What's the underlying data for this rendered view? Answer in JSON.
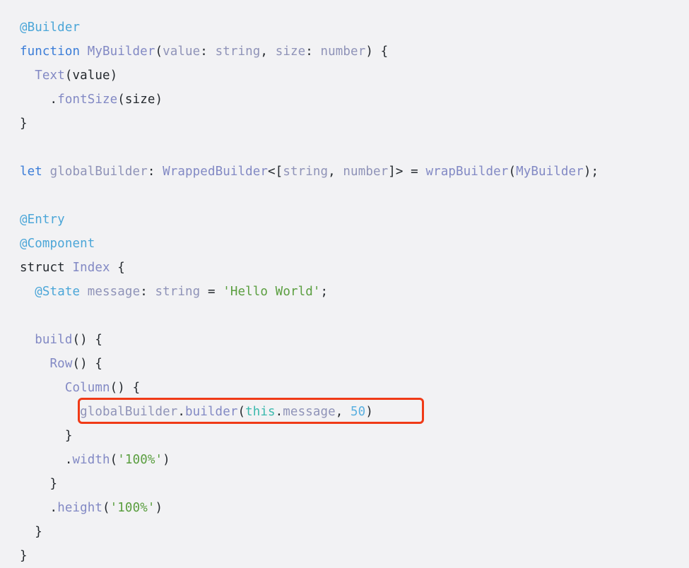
{
  "editor": {
    "background_color": "#f2f2f4",
    "default_text_color": "#24292e",
    "font_size_px": 17.5,
    "line_height_px": 34
  },
  "annotation": {
    "type": "rectangle-highlight",
    "color": "#f03a17",
    "border_width_px": 3,
    "border_radius_px": 6,
    "target_line_index": 16,
    "target_text": "globalBuilder.builder(this.message, 50)"
  },
  "colors": {
    "decorator": "#4ba6d8",
    "keyword": "#3b7dd8",
    "function_name": "#8289c4",
    "identifier": "#8f93b8",
    "type_name": "#8289c4",
    "plain": "#24292e",
    "string": "#5a9e3f",
    "this_keyword": "#3bb9ad",
    "number": "#5bb0e0"
  },
  "code": {
    "language": "ArkTS",
    "lines": [
      {
        "indent": 0,
        "tokens": [
          {
            "t": "@Builder",
            "c": "decorator"
          }
        ]
      },
      {
        "indent": 0,
        "tokens": [
          {
            "t": "function",
            "c": "keyword"
          },
          {
            "t": " ",
            "c": "plain"
          },
          {
            "t": "MyBuilder",
            "c": "function_name"
          },
          {
            "t": "(",
            "c": "plain"
          },
          {
            "t": "value",
            "c": "identifier"
          },
          {
            "t": ": ",
            "c": "plain"
          },
          {
            "t": "string",
            "c": "identifier"
          },
          {
            "t": ", ",
            "c": "plain"
          },
          {
            "t": "size",
            "c": "identifier"
          },
          {
            "t": ": ",
            "c": "plain"
          },
          {
            "t": "number",
            "c": "identifier"
          },
          {
            "t": ") {",
            "c": "plain"
          }
        ]
      },
      {
        "indent": 1,
        "tokens": [
          {
            "t": "Text",
            "c": "function_name"
          },
          {
            "t": "(value)",
            "c": "plain"
          }
        ]
      },
      {
        "indent": 2,
        "tokens": [
          {
            "t": ".",
            "c": "plain"
          },
          {
            "t": "fontSize",
            "c": "function_name"
          },
          {
            "t": "(size)",
            "c": "plain"
          }
        ]
      },
      {
        "indent": 0,
        "tokens": [
          {
            "t": "}",
            "c": "plain"
          }
        ]
      },
      {
        "indent": 0,
        "tokens": []
      },
      {
        "indent": 0,
        "tokens": [
          {
            "t": "let",
            "c": "keyword"
          },
          {
            "t": " ",
            "c": "plain"
          },
          {
            "t": "globalBuilder",
            "c": "identifier"
          },
          {
            "t": ": ",
            "c": "plain"
          },
          {
            "t": "WrappedBuilder",
            "c": "type_name"
          },
          {
            "t": "<[",
            "c": "plain"
          },
          {
            "t": "string",
            "c": "identifier"
          },
          {
            "t": ", ",
            "c": "plain"
          },
          {
            "t": "number",
            "c": "identifier"
          },
          {
            "t": "]> = ",
            "c": "plain"
          },
          {
            "t": "wrapBuilder",
            "c": "function_name"
          },
          {
            "t": "(",
            "c": "plain"
          },
          {
            "t": "MyBuilder",
            "c": "function_name"
          },
          {
            "t": ");",
            "c": "plain"
          }
        ]
      },
      {
        "indent": 0,
        "tokens": []
      },
      {
        "indent": 0,
        "tokens": [
          {
            "t": "@Entry",
            "c": "decorator"
          }
        ]
      },
      {
        "indent": 0,
        "tokens": [
          {
            "t": "@Component",
            "c": "decorator"
          }
        ]
      },
      {
        "indent": 0,
        "tokens": [
          {
            "t": "struct",
            "c": "plain"
          },
          {
            "t": " ",
            "c": "plain"
          },
          {
            "t": "Index",
            "c": "type_name"
          },
          {
            "t": " {",
            "c": "plain"
          }
        ]
      },
      {
        "indent": 1,
        "tokens": [
          {
            "t": "@State",
            "c": "decorator"
          },
          {
            "t": " ",
            "c": "plain"
          },
          {
            "t": "message",
            "c": "identifier"
          },
          {
            "t": ": ",
            "c": "plain"
          },
          {
            "t": "string",
            "c": "identifier"
          },
          {
            "t": " = ",
            "c": "plain"
          },
          {
            "t": "'Hello World'",
            "c": "string"
          },
          {
            "t": ";",
            "c": "plain"
          }
        ]
      },
      {
        "indent": 0,
        "tokens": []
      },
      {
        "indent": 1,
        "tokens": [
          {
            "t": "build",
            "c": "function_name"
          },
          {
            "t": "() {",
            "c": "plain"
          }
        ]
      },
      {
        "indent": 2,
        "tokens": [
          {
            "t": "Row",
            "c": "function_name"
          },
          {
            "t": "() {",
            "c": "plain"
          }
        ]
      },
      {
        "indent": 3,
        "tokens": [
          {
            "t": "Column",
            "c": "function_name"
          },
          {
            "t": "() {",
            "c": "plain"
          }
        ]
      },
      {
        "indent": 4,
        "highlighted": true,
        "tokens": [
          {
            "t": "globalBuilder",
            "c": "identifier"
          },
          {
            "t": ".",
            "c": "plain"
          },
          {
            "t": "builder",
            "c": "function_name"
          },
          {
            "t": "(",
            "c": "plain"
          },
          {
            "t": "this",
            "c": "this_keyword"
          },
          {
            "t": ".",
            "c": "plain"
          },
          {
            "t": "message",
            "c": "identifier"
          },
          {
            "t": ", ",
            "c": "plain"
          },
          {
            "t": "50",
            "c": "number"
          },
          {
            "t": ")",
            "c": "plain"
          }
        ]
      },
      {
        "indent": 3,
        "tokens": [
          {
            "t": "}",
            "c": "plain"
          }
        ]
      },
      {
        "indent": 3,
        "tokens": [
          {
            "t": ".",
            "c": "plain"
          },
          {
            "t": "width",
            "c": "function_name"
          },
          {
            "t": "(",
            "c": "plain"
          },
          {
            "t": "'100%'",
            "c": "string"
          },
          {
            "t": ")",
            "c": "plain"
          }
        ]
      },
      {
        "indent": 2,
        "tokens": [
          {
            "t": "}",
            "c": "plain"
          }
        ]
      },
      {
        "indent": 2,
        "tokens": [
          {
            "t": ".",
            "c": "plain"
          },
          {
            "t": "height",
            "c": "function_name"
          },
          {
            "t": "(",
            "c": "plain"
          },
          {
            "t": "'100%'",
            "c": "string"
          },
          {
            "t": ")",
            "c": "plain"
          }
        ]
      },
      {
        "indent": 1,
        "tokens": [
          {
            "t": "}",
            "c": "plain"
          }
        ]
      },
      {
        "indent": 0,
        "tokens": [
          {
            "t": "}",
            "c": "plain"
          }
        ]
      }
    ]
  }
}
